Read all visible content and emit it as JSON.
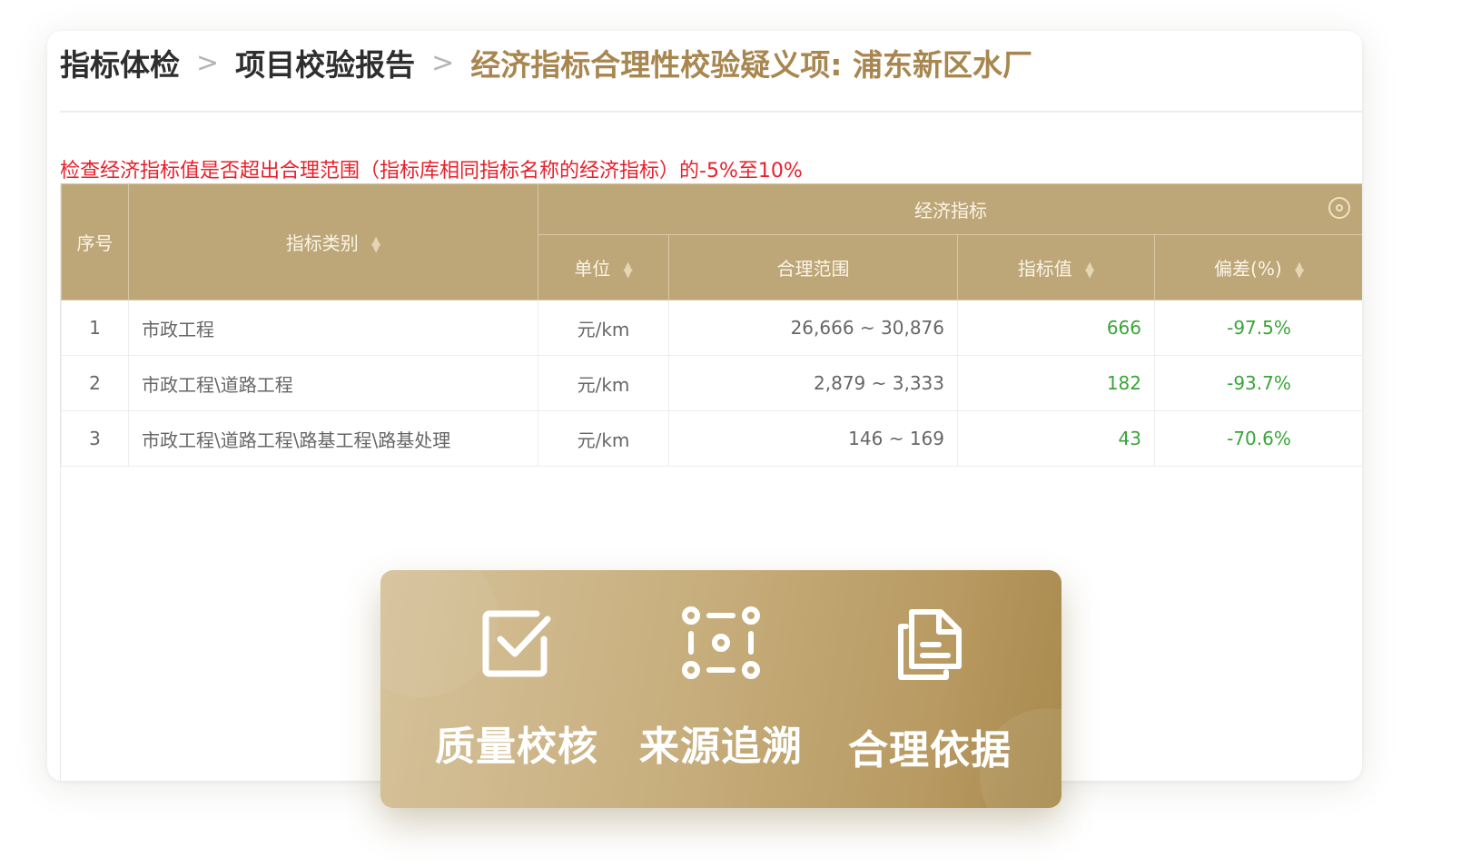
{
  "breadcrumb": {
    "items": [
      "指标体检",
      "项目校验报告"
    ],
    "current": "经济指标合理性校验疑义项: 浦东新区水厂"
  },
  "notice": "检查经济指标值是否超出合理范围（指标库相同指标名称的经济指标）的-5%至10%",
  "table": {
    "headers": {
      "index": "序号",
      "category": "指标类别",
      "group": "经济指标",
      "unit": "单位",
      "range": "合理范围",
      "value": "指标值",
      "deviation": "偏差(%)"
    },
    "rows": [
      {
        "index": "1",
        "category": "市政工程",
        "unit": "元/km",
        "range": "26,666 ~ 30,876",
        "value": "666",
        "deviation": "-97.5%"
      },
      {
        "index": "2",
        "category": "市政工程\\道路工程",
        "unit": "元/km",
        "range": "2,879 ~ 3,333",
        "value": "182",
        "deviation": "-93.7%"
      },
      {
        "index": "3",
        "category": "市政工程\\道路工程\\路基工程\\路基处理",
        "unit": "元/km",
        "range": "146 ~ 169",
        "value": "43",
        "deviation": "-70.6%"
      }
    ]
  },
  "features": [
    {
      "label": "质量校核",
      "icon": "checkbox-icon"
    },
    {
      "label": "来源追溯",
      "icon": "trace-nodes-icon"
    },
    {
      "label": "合理依据",
      "icon": "document-icon"
    }
  ],
  "colors": {
    "accent": "#bda677",
    "breadcrumb_current": "#a8864f",
    "notice": "#e8212c",
    "positive": "#3aa43a"
  }
}
